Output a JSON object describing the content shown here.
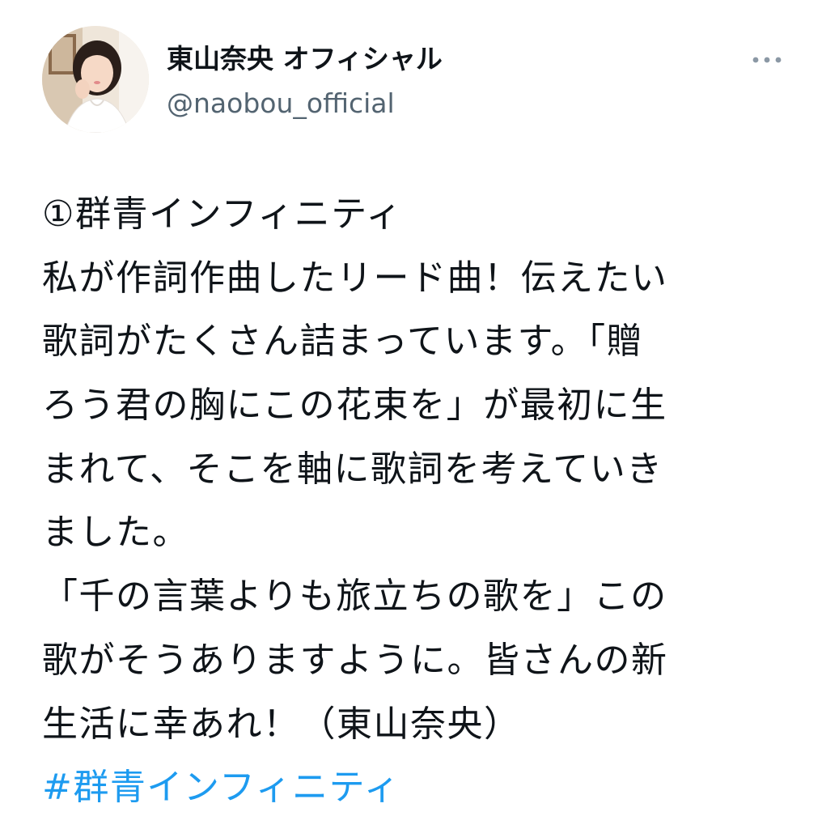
{
  "user": {
    "display_name": "東山奈央 オフィシャル",
    "handle": "@naobou_official"
  },
  "tweet": {
    "lines": [
      "①群青インフィニティ",
      "私が作詞作曲したリード曲！伝えたい",
      "歌詞がたくさん詰まっています。「贈",
      "ろう君の胸にこの花束を」が最初に生",
      "まれて、そこを軸に歌詞を考えていき",
      "ました。",
      "「千の言葉よりも旅立ちの歌を」この",
      "歌がそうありますように。皆さんの新",
      "生活に幸あれ！（東山奈央）"
    ],
    "hashtag": "#群青インフィニティ"
  },
  "icons": {
    "more": "more-horizontal-icon"
  },
  "colors": {
    "text": "#0f1419",
    "secondary": "#536471",
    "link": "#1d9bf0",
    "background": "#ffffff"
  }
}
